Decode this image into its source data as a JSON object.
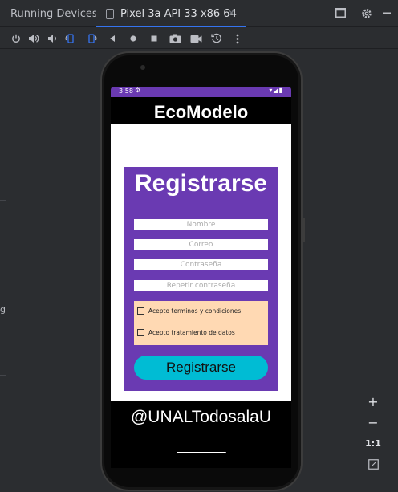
{
  "ide": {
    "running_devices_label": "Running Devices:",
    "device_tab_label": "Pixel 3a API 33 x86 64",
    "tab_close": "×",
    "gutter_label": "g"
  },
  "toolbar": {
    "icons": [
      "power-icon",
      "volume-up-icon",
      "volume-down-icon",
      "rotate-left-icon",
      "rotate-right-icon",
      "back-icon",
      "home-icon",
      "overview-icon",
      "screenshot-icon",
      "screen-record-icon",
      "snapshot-icon",
      "more-icon"
    ]
  },
  "zoom": {
    "plus": "+",
    "minus": "−",
    "actual": "1:1"
  },
  "phone": {
    "status_time": "3:58",
    "app_title": "EcoModelo",
    "form": {
      "heading": "Registrarse",
      "name_placeholder": "Nombre",
      "email_placeholder": "Correo",
      "password_placeholder": "Contraseña",
      "repeat_password_placeholder": "Repetir contraseña",
      "accept_terms_label": "Acepto terminos y condiciones",
      "accept_data_label": "Acepto tratamiento de datos",
      "submit_label": "Registrarse"
    },
    "footer": "@UNALTodosalaU"
  },
  "colors": {
    "accent_purple": "#6a3ab2",
    "button_cyan": "#00bcd4",
    "terms_bg": "#ffd9b3",
    "ide_bg": "#2b2d30",
    "tab_underline": "#3574f0"
  }
}
